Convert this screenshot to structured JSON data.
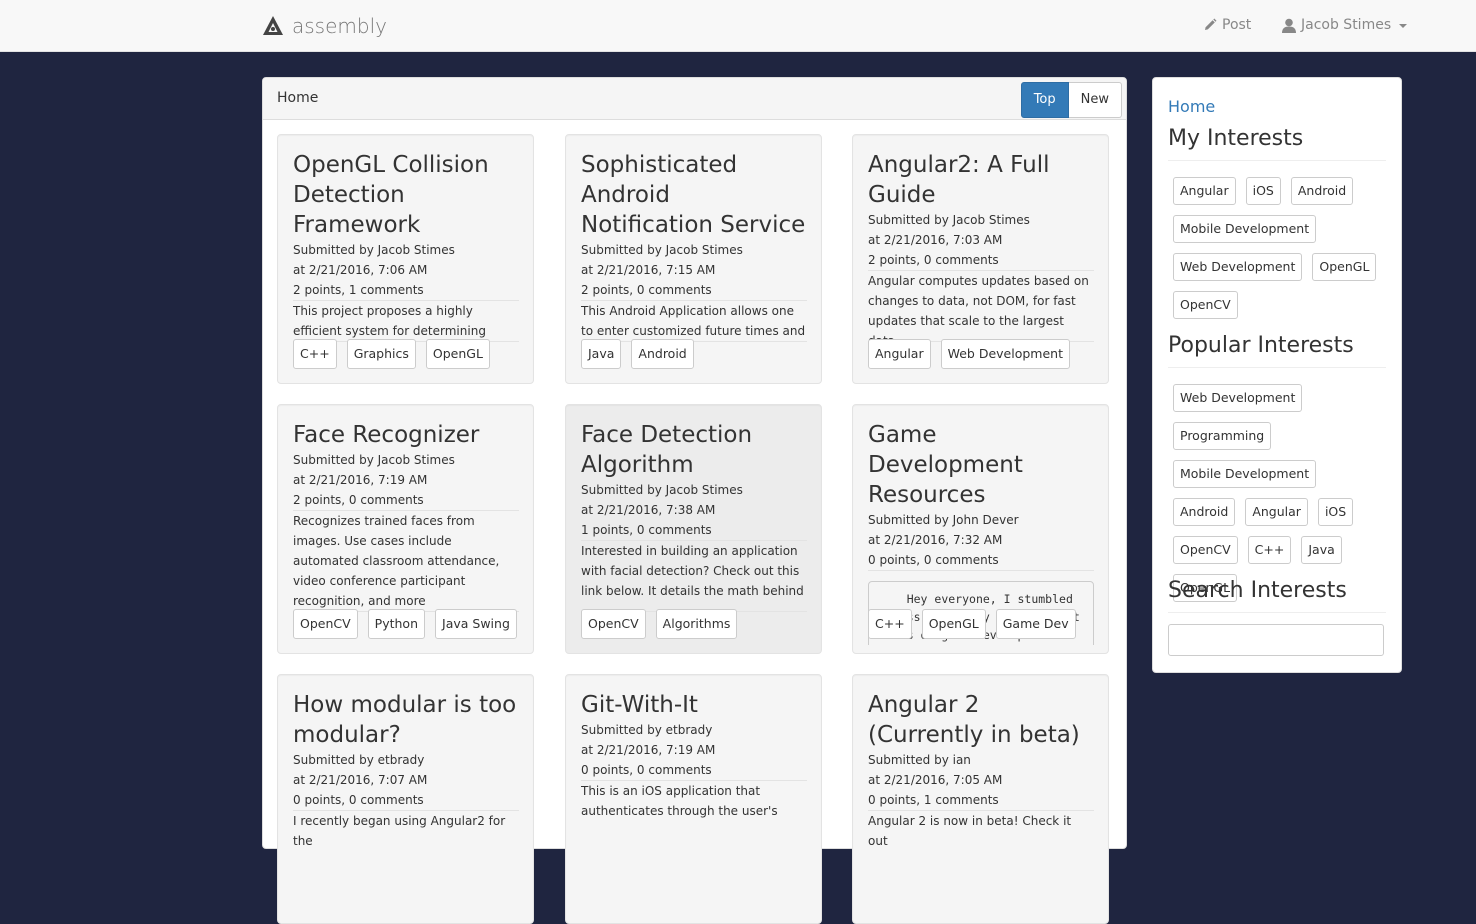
{
  "navbar": {
    "brand": "assembly",
    "post_label": "Post",
    "user_name": "Jacob Stimes"
  },
  "feed": {
    "title": "Home",
    "sort_top": "Top",
    "sort_new": "New",
    "cards": [
      {
        "title": "OpenGL Collision Detection Framework",
        "submitted": "Submitted by Jacob Stimes",
        "time": "at 2/21/2016, 7:06 AM",
        "stats": "2 points, 1 comments",
        "desc": "This project proposes a highly efficient system for determining closest points",
        "tags": [
          "C++",
          "Graphics",
          "OpenGL"
        ]
      },
      {
        "title": "Sophisticated Android Notification Service",
        "submitted": "Submitted by Jacob Stimes",
        "time": "at 2/21/2016, 7:15 AM",
        "stats": "2 points, 0 comments",
        "desc": "This Android Application allows one to enter customized future times and",
        "tags": [
          "Java",
          "Android"
        ]
      },
      {
        "title": "Angular2: A Full Guide",
        "submitted": "Submitted by Jacob Stimes",
        "time": "at 2/21/2016, 7:03 AM",
        "stats": "2 points, 0 comments",
        "desc": "Angular computes updates based on changes to data, not DOM, for fast updates that scale to the largest data",
        "tags": [
          "Angular",
          "Web Development"
        ]
      },
      {
        "title": "Face Recognizer",
        "submitted": "Submitted by Jacob Stimes",
        "time": "at 2/21/2016, 7:19 AM",
        "stats": "2 points, 0 comments",
        "desc": "Recognizes trained faces from images. Use cases include automated classroom attendance, video conference participant recognition, and more",
        "tags": [
          "OpenCV",
          "Python",
          "Java Swing"
        ]
      },
      {
        "title": "Face Detection Algorithm",
        "submitted": "Submitted by Jacob Stimes",
        "time": "at 2/21/2016, 7:38 AM",
        "stats": "1 points, 0 comments",
        "desc": "Interested in building an application with facial detection? Check out this link below. It details the math behind",
        "tags": [
          "OpenCV",
          "Algorithms"
        ]
      },
      {
        "title": "Game Development Resources",
        "submitted": "Submitted by John Dever",
        "time": "at 2/21/2016, 7:32 AM",
        "stats": "0 points, 0 comments",
        "code": "    Hey everyone, I stumbled across some very in-depth articles on game development a",
        "tags": [
          "C++",
          "OpenGL",
          "Game Dev"
        ]
      },
      {
        "title": "How modular is too modular?",
        "submitted": "Submitted by etbrady",
        "time": "at 2/21/2016, 7:07 AM",
        "stats": "0 points, 0 comments",
        "desc": "I recently began using Angular2 for the",
        "tags": []
      },
      {
        "title": "Git-With-It",
        "submitted": "Submitted by etbrady",
        "time": "at 2/21/2016, 7:19 AM",
        "stats": "0 points, 0 comments",
        "desc": "This is an iOS application that authenticates through the user's",
        "tags": []
      },
      {
        "title": "Angular 2 (Currently in beta)",
        "submitted": "Submitted by ian",
        "time": "at 2/21/2016, 7:05 AM",
        "stats": "0 points, 1 comments",
        "desc": "Angular 2 is now in beta! Check it out",
        "tags": []
      }
    ]
  },
  "sidebar": {
    "home_link": "Home",
    "my_interests_title": "My Interests",
    "my_interests": [
      "Angular",
      "iOS",
      "Android",
      "Mobile Development",
      "Web Development",
      "OpenGL",
      "OpenCV"
    ],
    "popular_title": "Popular Interests",
    "popular": [
      "Web Development",
      "Programming",
      "Mobile Development",
      "Android",
      "Angular",
      "iOS",
      "OpenCV",
      "C++",
      "Java",
      "OpenGL"
    ],
    "search_title": "Search Interests",
    "search_value": ""
  },
  "colors": {
    "page_background": "#1f2540",
    "accent": "#337ab7"
  }
}
